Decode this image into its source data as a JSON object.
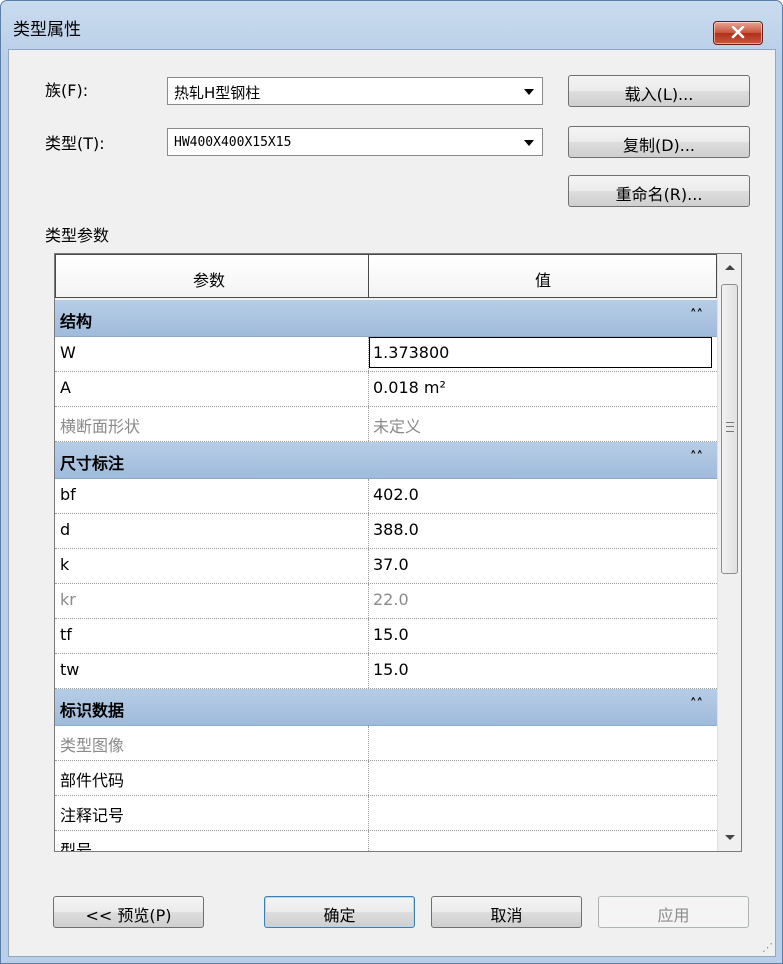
{
  "window": {
    "title": "类型属性"
  },
  "family": {
    "label": "族(F):",
    "value": "热轧H型钢柱"
  },
  "type": {
    "label": "类型(T):",
    "value": "HW400X400X15X15"
  },
  "buttons": {
    "load": "载入(L)...",
    "duplicate": "复制(D)...",
    "rename": "重命名(R)...",
    "preview": "<< 预览(P)",
    "ok": "确定",
    "cancel": "取消",
    "apply": "应用"
  },
  "group_label": "类型参数",
  "table": {
    "headers": {
      "param": "参数",
      "value": "值"
    },
    "sections": [
      {
        "name": "结构",
        "rows": [
          {
            "param": "W",
            "value": "1.373800"
          },
          {
            "param": "A",
            "value": "0.018 m²"
          },
          {
            "param": "横断面形状",
            "value": "未定义"
          }
        ]
      },
      {
        "name": "尺寸标注",
        "rows": [
          {
            "param": "bf",
            "value": "402.0"
          },
          {
            "param": "d",
            "value": "388.0"
          },
          {
            "param": "k",
            "value": "37.0"
          },
          {
            "param": "kr",
            "value": "22.0"
          },
          {
            "param": "tf",
            "value": "15.0"
          },
          {
            "param": "tw",
            "value": "15.0"
          }
        ]
      },
      {
        "name": "标识数据",
        "rows": [
          {
            "param": "类型图像",
            "value": ""
          },
          {
            "param": "部件代码",
            "value": ""
          },
          {
            "param": "注释记号",
            "value": ""
          },
          {
            "param": "型号",
            "value": ""
          }
        ]
      }
    ]
  },
  "icons": {
    "close": "close-icon",
    "collapse": "double-chevron-up-icon",
    "dropdown": "dropdown-arrow-icon"
  },
  "colors": {
    "close_button": "#c9523c",
    "category_row": "#a9c2df",
    "title_bar": "#b9cfe7"
  }
}
